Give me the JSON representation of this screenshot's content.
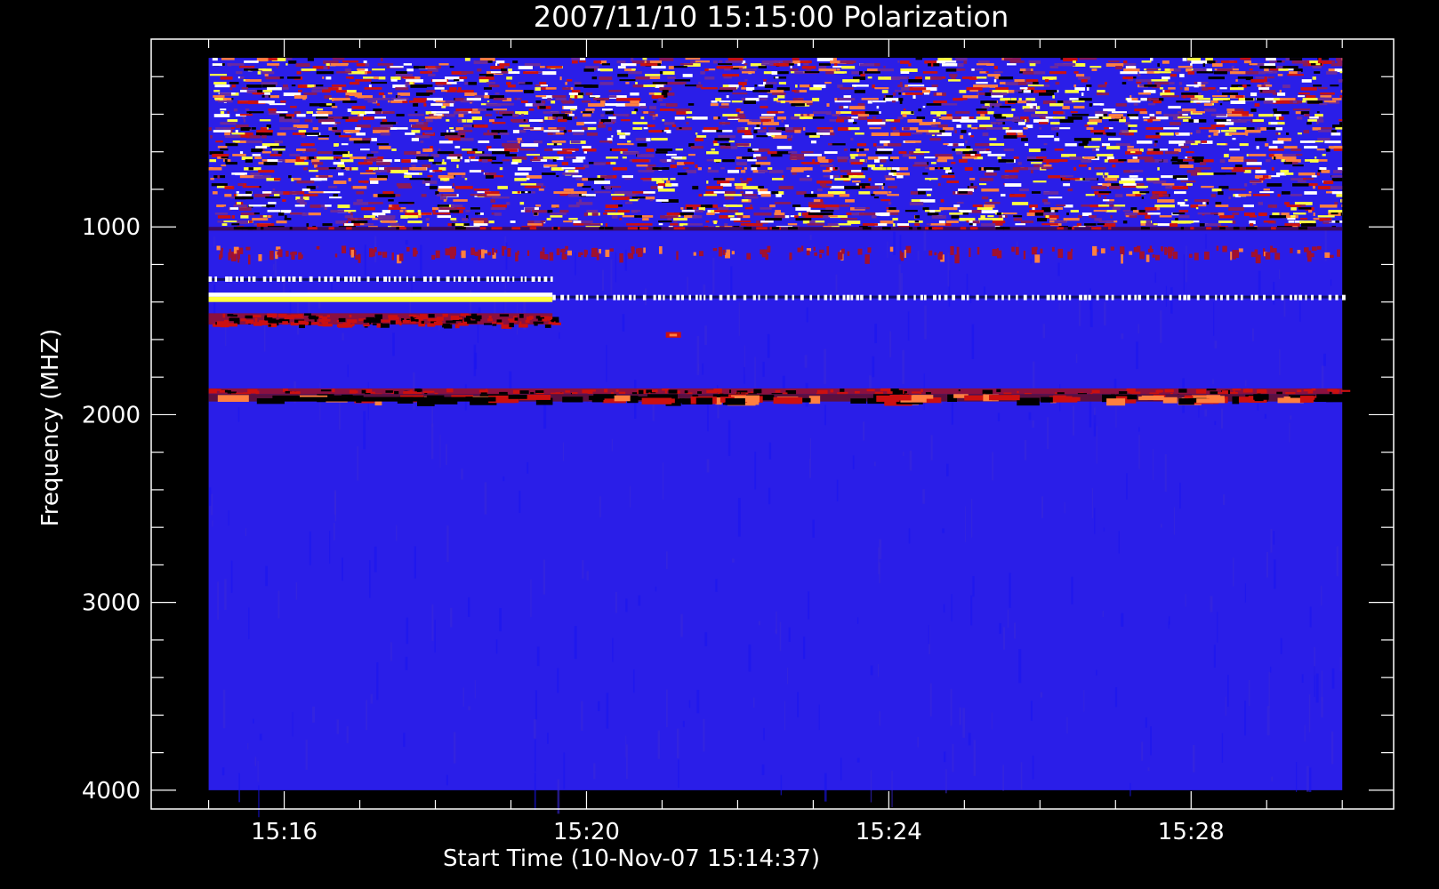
{
  "chart_data": {
    "type": "heatmap",
    "title": "2007/11/10 15:15:00 Polarization",
    "xlabel": "Start Time (10-Nov-07 15:14:37)",
    "ylabel": "Frequency (MHZ)",
    "x_ticks": [
      "15:16",
      "15:20",
      "15:24",
      "15:28"
    ],
    "x_tick_minutes": [
      16,
      20,
      24,
      28
    ],
    "y_ticks": [
      "1000",
      "2000",
      "3000",
      "4000"
    ],
    "y_tick_values": [
      1000,
      2000,
      3000,
      4000
    ],
    "xlim_minutes": [
      14.24,
      30.68
    ],
    "ylim_mhz": [
      4100,
      0
    ],
    "data_time_range_minutes": [
      15.0,
      30.0
    ],
    "data_freq_range_mhz": [
      100,
      4000
    ],
    "y_axis_inverted": true,
    "grid": false,
    "colors": {
      "background": "#000000",
      "axes": "#ffffff",
      "base": "#2a1ee8",
      "black": "#000000",
      "red": "#cc1010",
      "orange": "#ff8040",
      "yellow": "#ffff40",
      "white": "#ffffff"
    },
    "bands": [
      {
        "f0": 100,
        "f1": 1000,
        "pattern": "noisy",
        "level": 0.6
      },
      {
        "f0": 1000,
        "f1": 1020,
        "pattern": "dark-line"
      },
      {
        "f0": 1100,
        "f1": 1150,
        "pattern": "sparse-red"
      },
      {
        "f0": 1240,
        "f1": 1300,
        "pattern": "white-dashes",
        "t0": 15.0,
        "t1": 19.55
      },
      {
        "f0": 1350,
        "f1": 1380,
        "pattern": "white-ticks",
        "t0": 19.55,
        "t1": 30.0
      },
      {
        "f0": 1350,
        "f1": 1400,
        "pattern": "yellow-solid",
        "t0": 15.0,
        "t1": 19.55
      },
      {
        "f0": 1460,
        "f1": 1520,
        "pattern": "red-stripe",
        "t0": 15.0,
        "t1": 19.55
      },
      {
        "f0": 1560,
        "f1": 1590,
        "pattern": "hot-spot",
        "t0": 21.05,
        "t1": 21.25
      },
      {
        "f0": 1860,
        "f1": 1890,
        "pattern": "red-stripe",
        "t0": 15.0,
        "t1": 30.0
      },
      {
        "f0": 1890,
        "f1": 1930,
        "pattern": "orange-dark",
        "t0": 15.0,
        "t1": 30.0
      },
      {
        "f0": 1930,
        "f1": 4000,
        "pattern": "quiet"
      }
    ]
  }
}
